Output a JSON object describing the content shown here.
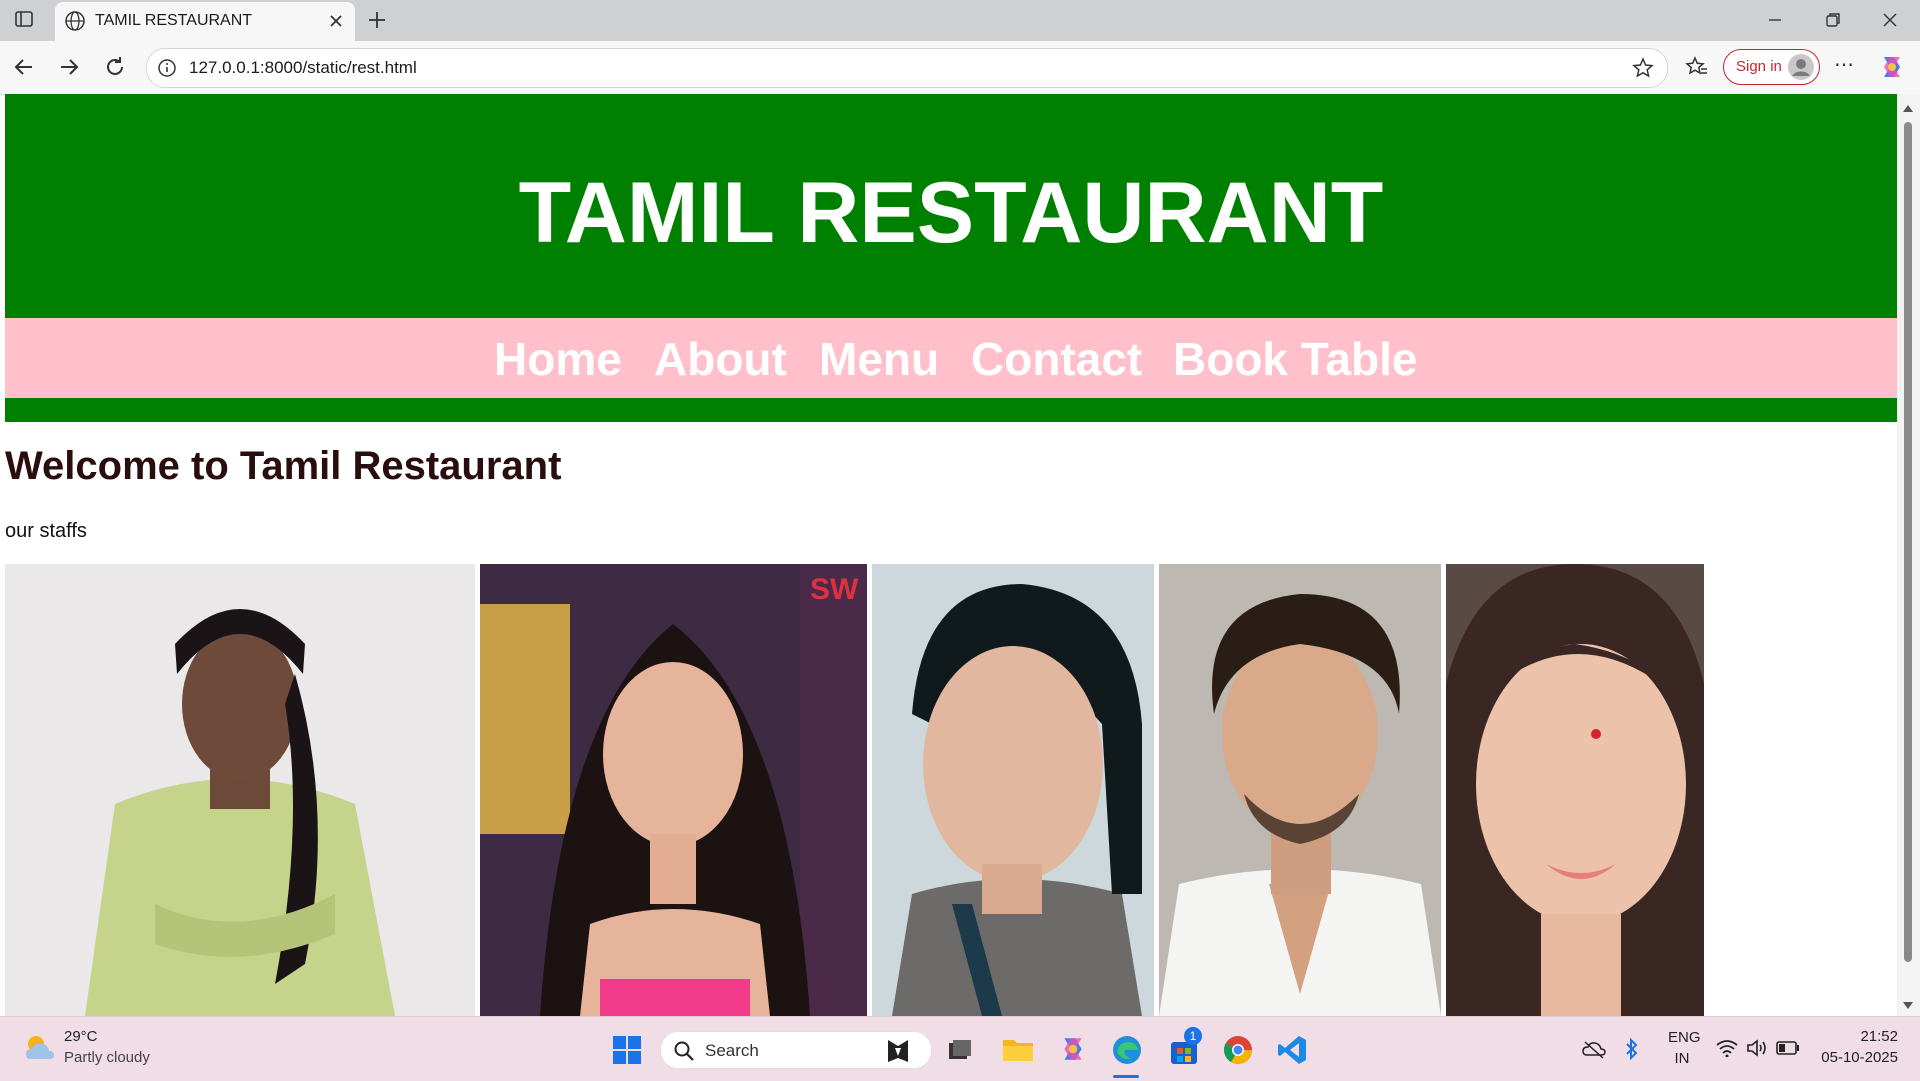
{
  "browser": {
    "tab_title": "TAMIL RESTAURANT",
    "url": "127.0.0.1:8000/static/rest.html",
    "signin_label": "Sign in"
  },
  "page": {
    "site_title": "TAMIL RESTAURANT",
    "nav": [
      "Home",
      "About",
      "Menu",
      "Contact",
      "Book Table"
    ],
    "welcome_heading": "Welcome to Tamil Restaurant",
    "staff_caption": "our staffs",
    "staff_photos": [
      "staff-photo-1",
      "staff-photo-2",
      "staff-photo-3",
      "staff-photo-4",
      "staff-photo-5"
    ],
    "colors": {
      "header_green": "#008000",
      "nav_pink": "#ffc0cb",
      "heading_text": "#2a0e0e"
    }
  },
  "taskbar": {
    "weather_temp": "29°C",
    "weather_desc": "Partly cloudy",
    "search_label": "Search",
    "language_line1": "ENG",
    "language_line2": "IN",
    "time": "21:52",
    "date": "05-10-2025",
    "store_badge": "1"
  }
}
